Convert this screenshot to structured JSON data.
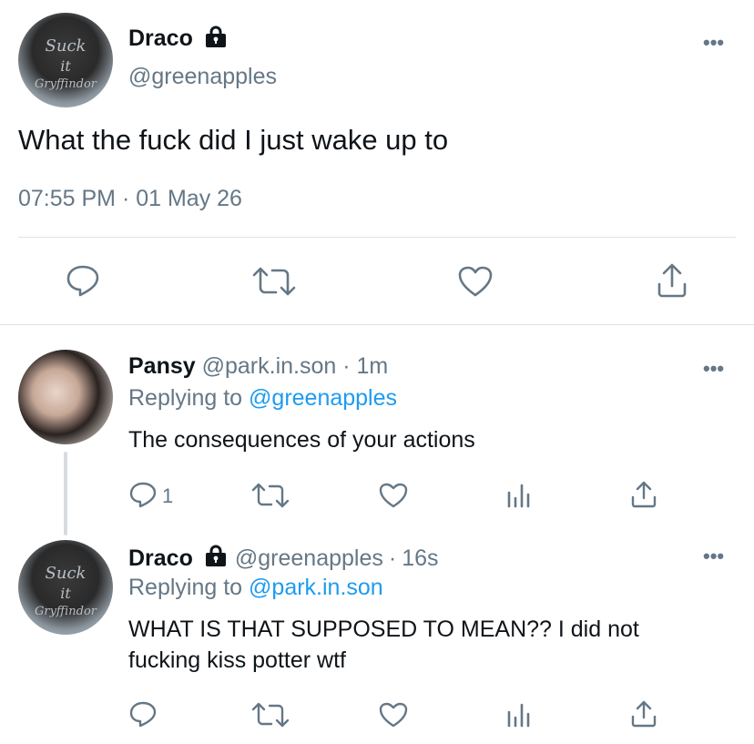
{
  "main_tweet": {
    "display_name": "Draco",
    "handle": "@greenapples",
    "text": "What the fuck did I just wake up to",
    "timestamp": "07:55 PM · 01 May 26",
    "avatar_text": [
      "Suck",
      "it",
      "Gryffindor"
    ]
  },
  "replies": [
    {
      "display_name": "Pansy",
      "handle": "@park.in.son",
      "separator": "·",
      "time": "1m",
      "replying_label": "Replying to",
      "replying_to": "@greenapples",
      "text": "The consequences of your actions",
      "reply_count": "1"
    },
    {
      "display_name": "Draco",
      "handle": "@greenapples",
      "separator": "·",
      "time": "16s",
      "replying_label": "Replying to",
      "replying_to": "@park.in.son",
      "text_line1": "WHAT IS THAT SUPPOSED TO MEAN?? I did not",
      "text_line2": "fucking kiss potter wtf",
      "avatar_text": [
        "Suck",
        "it",
        "Gryffindor"
      ]
    }
  ],
  "icons": {
    "reply": "reply-icon",
    "retweet": "retweet-icon",
    "like": "heart-icon",
    "share": "share-icon",
    "analytics": "analytics-icon",
    "more": "more-options-icon",
    "lock": "lock-icon"
  },
  "colors": {
    "text": "#0f1419",
    "muted": "#657786",
    "link": "#1d9bf0",
    "divider": "#dfe3e6"
  }
}
